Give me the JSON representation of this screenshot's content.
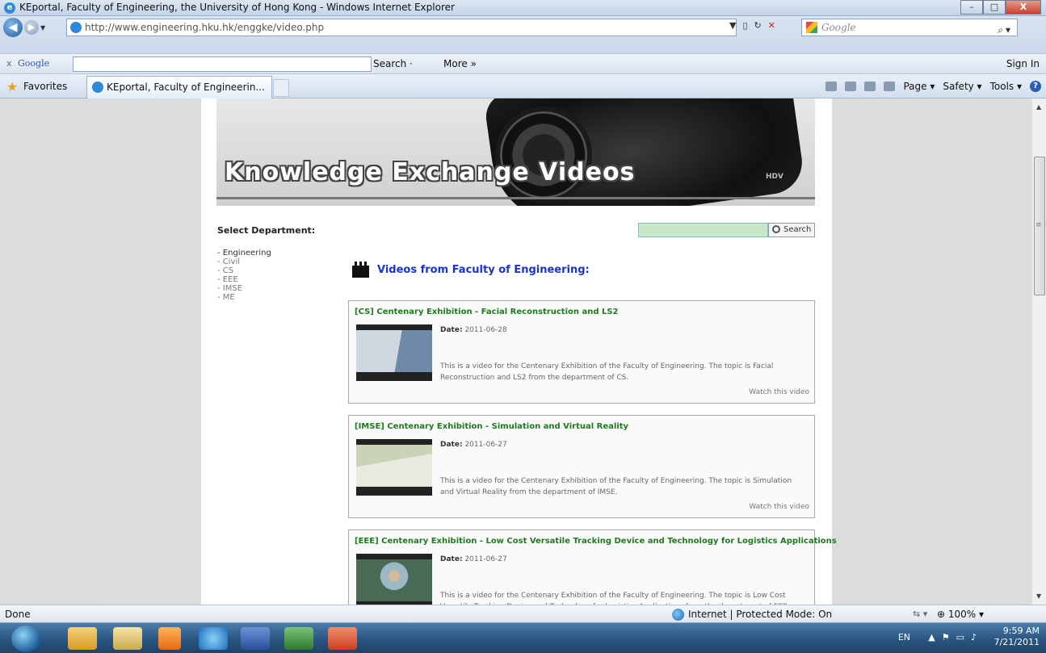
{
  "window": {
    "title": "KEportal, Faculty of Engineering, the University of Hong Kong - Windows Internet Explorer",
    "minimize": "–",
    "maximize": "□",
    "close": "X"
  },
  "navigation": {
    "address": "http://www.engineering.hku.hk/enggke/video.php",
    "search_engine": "Google"
  },
  "google_toolbar": {
    "close": "x",
    "logo": "Google",
    "search_label": "Search ·",
    "more_label": "More »",
    "sign_in": "Sign In"
  },
  "favorites_bar": {
    "favorites_label": "Favorites",
    "tab_label": "KEportal, Faculty of Engineerin...",
    "commands": [
      "Page ▾",
      "Safety ▾",
      "Tools ▾"
    ]
  },
  "page": {
    "banner_title": "Knowledge Exchange Videos",
    "banner_cam_label": "HDV",
    "select_department": "Select Department:",
    "departments": [
      "- Engineering",
      "- Civil",
      "- CS",
      "- EEE",
      "- IMSE",
      "- ME"
    ],
    "search_button": "Search",
    "videos_heading": "Videos from Faculty of Engineering:",
    "date_label": "Date:",
    "videos": [
      {
        "title": "[CS] Centenary Exhibition - Facial Reconstruction and LS2",
        "date": "2011-06-28",
        "description": "This is a video for the Centenary Exhibition of the Faculty of Engineering. The topic is Facial Reconstruction and LS2 from the department of CS.",
        "watch": "Watch this video"
      },
      {
        "title": "[IMSE] Centenary Exhibition - Simulation and Virtual Reality",
        "date": "2011-06-27",
        "description": "This is a video for the Centenary Exhibition of the Faculty of Engineering. The topic is Simulation and Virtual Reality from the department of IMSE.",
        "watch": "Watch this video"
      },
      {
        "title": "[EEE] Centenary Exhibition - Low Cost Versatile Tracking Device and Technology for Logistics Applications",
        "date": "2011-06-27",
        "description": "This is a video for the Centenary Exhibition of the Faculty of Engineering. The topic is Low Cost Versatile Tracking Device and Technology for Logistics Applications from the department of EEE.",
        "watch": ""
      }
    ]
  },
  "statusbar": {
    "status": "Done",
    "zone": "Internet | Protected Mode: On",
    "zoom": "100%"
  },
  "taskbar": {
    "language": "EN",
    "time": "9:59 AM",
    "date": "7/21/2011"
  },
  "colors": {
    "video_title": "#1e7a1e",
    "heading": "#1a33c8",
    "search_field": "#c8e8c8"
  }
}
